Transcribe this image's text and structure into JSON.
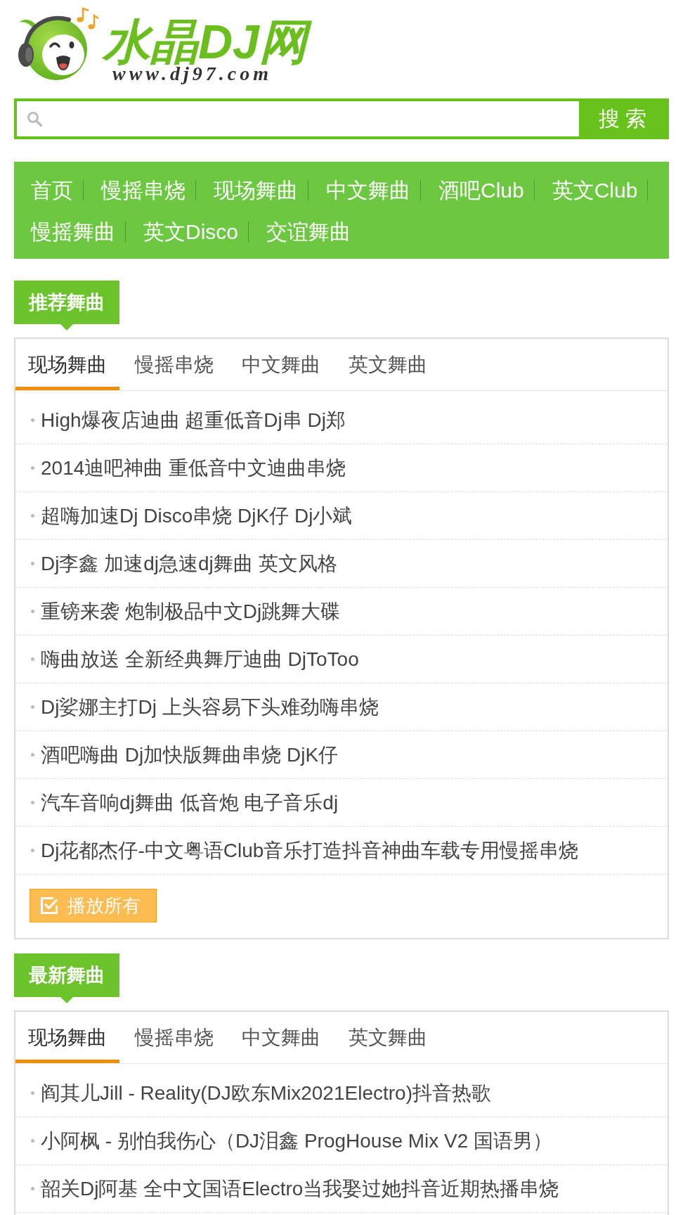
{
  "logo": {
    "title": "水晶DJ网",
    "url": "www.dj97.com"
  },
  "search": {
    "button": "搜 索"
  },
  "nav": [
    "首页",
    "慢摇串烧",
    "现场舞曲",
    "中文舞曲",
    "酒吧Club",
    "英文Club",
    "慢摇舞曲",
    "英文Disco",
    "交谊舞曲"
  ],
  "sections": [
    {
      "title": "推荐舞曲",
      "tabs": [
        {
          "label": "现场舞曲",
          "selected": true
        },
        {
          "label": "慢摇串烧",
          "selected": false
        },
        {
          "label": "中文舞曲",
          "selected": false
        },
        {
          "label": "英文舞曲",
          "selected": false
        }
      ],
      "songs": [
        "High爆夜店迪曲 超重低音Dj串 Dj郑",
        "2014迪吧神曲 重低音中文迪曲串烧",
        "超嗨加速Dj Disco串烧 DjK仔 Dj小斌",
        "Dj李鑫 加速dj急速dj舞曲 英文风格",
        "重镑来袭 炮制极品中文Dj跳舞大碟",
        "嗨曲放送 全新经典舞厅迪曲 DjToToo",
        "Dj娑娜主打Dj 上头容易下头难劲嗨串烧",
        "酒吧嗨曲 Dj加快版舞曲串烧 DjK仔",
        "汽车音响dj舞曲 低音炮 电子音乐dj",
        "Dj花都杰仔-中文粤语Club音乐打造抖音神曲车载专用慢摇串烧"
      ],
      "play_all": "播放所有"
    },
    {
      "title": "最新舞曲",
      "tabs": [
        {
          "label": "现场舞曲",
          "selected": true
        },
        {
          "label": "慢摇串烧",
          "selected": false
        },
        {
          "label": "中文舞曲",
          "selected": false
        },
        {
          "label": "英文舞曲",
          "selected": false
        }
      ],
      "songs": [
        "阎其儿Jill - Reality(DJ欧东Mix2021Electro)抖音热歌",
        "小阿枫 - 别怕我伤心（DJ泪鑫 ProgHouse Mix V2 国语男）",
        "韶关Dj阿基 全中文国语Electro当我娶过她抖音近期热播串烧"
      ]
    }
  ]
}
